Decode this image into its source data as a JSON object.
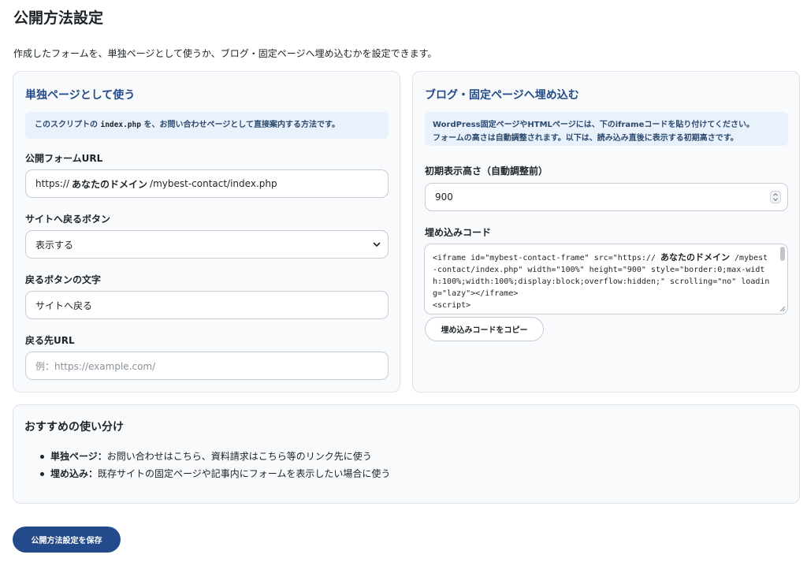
{
  "page": {
    "title": "公開方法設定",
    "description": "作成したフォームを、単独ページとして使うか、ブログ・固定ページへ埋め込むかを設定できます。"
  },
  "standalone": {
    "heading": "単独ページとして使う",
    "info_pre": "このスクリプトの",
    "info_code": "index.php",
    "info_post": "を、お問い合わせページとして直接案内する方法です。",
    "public_url_label": "公開フォームURL",
    "public_url_prefix": "https://",
    "public_url_domain": "あなたのドメイン",
    "public_url_suffix": "/mybest-contact/index.php",
    "back_button_label": "サイトへ戻るボタン",
    "back_button_value": "表示する",
    "back_text_label": "戻るボタンの文字",
    "back_text_value": "サイトへ戻る",
    "back_url_label": "戻る先URL",
    "back_url_placeholder": "例：https://example.com/"
  },
  "embed": {
    "heading": "ブログ・固定ページへ埋め込む",
    "info_line1": "WordPress固定ページやHTMLページには、下のiframeコードを貼り付けてください。",
    "info_line2": "フォームの高さは自動調整されます。以下は、読み込み直後に表示する初期高さです。",
    "initial_height_label": "初期表示高さ（自動調整前）",
    "initial_height_value": "900",
    "code_label": "埋め込みコード",
    "code_part1": "<iframe id=\"mybest-contact-frame\" src=\"https://",
    "code_domain": "あなたのドメイン",
    "code_part2": "/mybest-contact/index.php\" width=\"100%\" height=\"900\" style=\"border:0;max-width:100%;width:100%;display:block;overflow:hidden;\" scrolling=\"no\" loading=\"lazy\"></iframe>\n<script>",
    "copy_button": "埋め込みコードをコピー"
  },
  "recommendation": {
    "heading": "おすすめの使い分け",
    "items": [
      {
        "term": "単独ページ：",
        "text": "お問い合わせはこちら、資料請求はこちら等のリンク先に使う"
      },
      {
        "term": "埋め込み：",
        "text": "既存サイトの固定ページや記事内にフォームを表示したい場合に使う"
      }
    ]
  },
  "save_button": "公開方法設定を保存",
  "colors": {
    "accent": "#234a8a",
    "info_bg": "#e9f1fd",
    "card_bg": "#f8fafc"
  }
}
